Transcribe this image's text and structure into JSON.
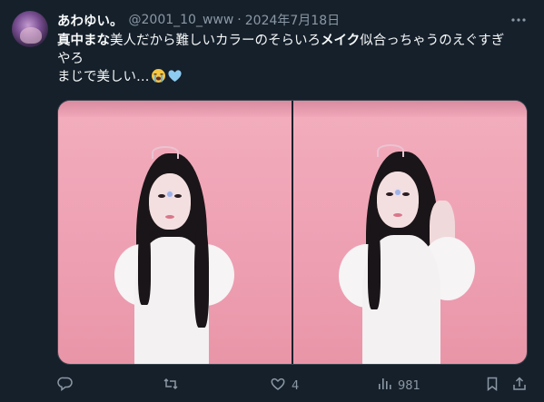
{
  "tweet": {
    "display_name": "あわゆい。",
    "handle": "@2001_10_www",
    "separator": "·",
    "date": "2024年7月18日",
    "text_line1_bold1": "真中まな",
    "text_line1_part2": "美人だから難しいカラーのそらいろ",
    "text_line1_bold2": "メイク",
    "text_line1_part3": "似合っちゃうのえぐすぎ",
    "text_line2": "やろ",
    "text_line3": "まじで美しい…",
    "emojis": [
      "loudly-crying-face",
      "light-blue-heart"
    ]
  },
  "actions": {
    "reply_count": "",
    "retweet_count": "",
    "like_count": "4",
    "views_count": "981"
  },
  "colors": {
    "background": "#15202b",
    "text": "#f7f9f9",
    "muted": "#8b98a5",
    "border": "#38444d",
    "photo_pink": "#f2aebd"
  },
  "icons": [
    "more-icon",
    "reply-icon",
    "retweet-icon",
    "like-icon",
    "views-icon",
    "bookmark-icon",
    "share-icon"
  ]
}
